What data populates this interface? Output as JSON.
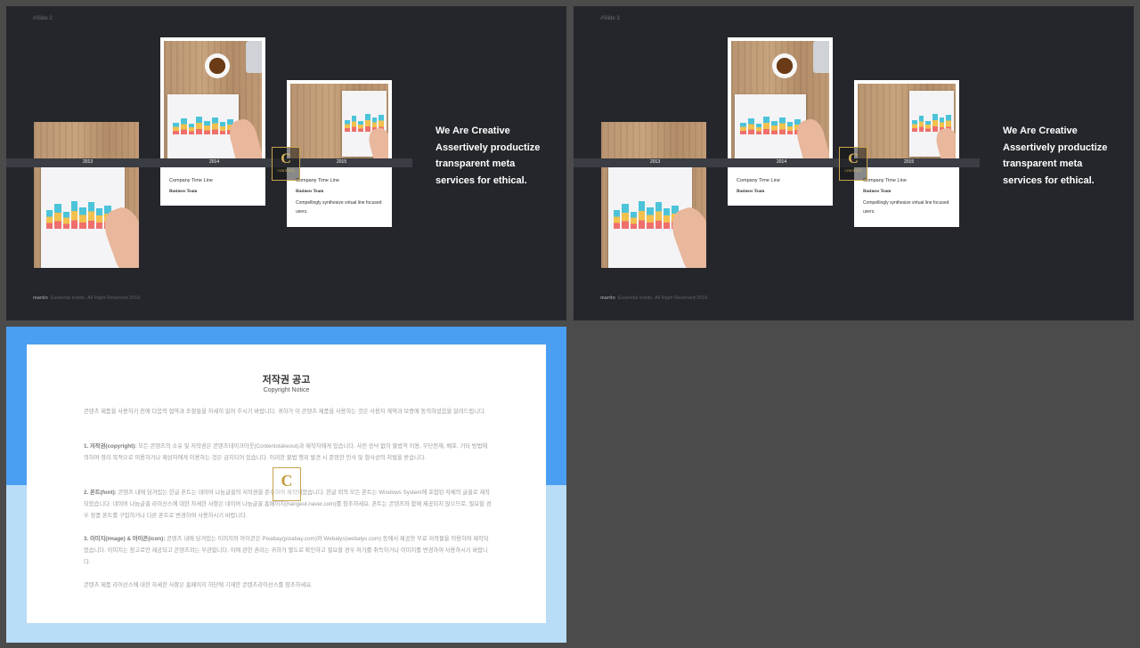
{
  "slides": [
    {
      "slide_number": "#Slide  2",
      "cards": [
        {
          "year": "2013"
        },
        {
          "year": "2014",
          "title": "Company Time Line",
          "subtitle": "Business Team"
        },
        {
          "year": "2015",
          "title": "Company Time Line",
          "subtitle": "Business Team",
          "desc": "Compellingly synthesize virtual line focused users."
        }
      ],
      "headline": [
        "We Are Creative",
        "Assertively productize",
        "transparent meta",
        "services for ethical."
      ],
      "footer_brand": "martin",
      "footer_text": "Essential Inside. All Right Reserved 2016"
    },
    {
      "slide_number": "#Slide  3",
      "cards": [
        {
          "year": "2013"
        },
        {
          "year": "2014",
          "title": "Company Time Line",
          "subtitle": "Business Team"
        },
        {
          "year": "2015",
          "title": "Company Time Line",
          "subtitle": "Business Team",
          "desc": "Compellingly synthesize virtual line focused users."
        }
      ],
      "headline": [
        "We Are Creative",
        "Assertively productize",
        "transparent meta",
        "services for ethical."
      ],
      "footer_brand": "martin",
      "footer_text": "Essential Inside. All Right Reserved 2016"
    }
  ],
  "logo": {
    "letter": "C",
    "text": "CONTENTS"
  },
  "copyright": {
    "title": "저작권 공고",
    "subtitle": "Copyright Notice",
    "intro": "콘텐츠 제품을 사용하기 전에 다음의 협약과 조항들을 자세히 읽어 주시기 바랍니다. 귀하가 이 콘텐츠 제품을 사용하는 것은 사용자 계약과 보증에 동의하셨음을 알려드립니다.",
    "sections": [
      {
        "heading": "1. 저작권(copyright):",
        "body": " 모든 콘텐츠의 소유 및 저작권은 콘텐츠테이크아웃(Contentstakeout)과 제작자에게 있습니다. 사전 승낙 없이 불법적 이용, 무단전재, 배포, 기타 방법에 의하여 영리 목적으로 이용하거나 제삼자에게 이용하는 것은 금지되어 있습니다. 이러한 불법 행위 발견 시 준엄한 민사 및 형사상의 처벌을 받습니다."
      },
      {
        "heading": "2. 폰트(font):",
        "body": " 콘텐츠 내에 담겨있는 한글 폰트는 네이버 나눔글꼴의 저작권을 준수하여 제작되었습니다. 한글 외의 모든 폰트는 Windows System에 포함된 자체의 글꼴로 제작되었습니다. 네이버 나눔글꼴 라이선스에 대한 자세한 사항은 네이버 나눔글꼴 홈페이지(hangeul.naver.com)를 참조하세요. 폰트는 콘텐츠와 함께 제공되지 않으므로, 필요할 경우 정품 폰트를 구입하거나 다른 폰트로 변경하여 사용하시기 바랍니다."
      },
      {
        "heading": "3. 이미지(image) & 아이콘(icon):",
        "body": " 콘텐츠 내에 담겨있는 이미지와 아이콘은 Pixabay(pixabay.com)와 Webalys(webalys.com) 등에서 제공한 무료 저작물을 이용하여 제작되었습니다. 이미지는 참고로만 제공되고 콘텐츠와는 무관합니다. 이에 관한 권리는 귀하가 별도로 확인하고 필요할 경우 허가를 취득하거나 이미지를 변경하여 사용하시기 바랍니다."
      }
    ],
    "closing": "콘텐츠 제품 라이선스에 대한 자세한 사항은 홈페이지 하단에 기재한 콘텐츠라이선스를 참조하세요."
  }
}
